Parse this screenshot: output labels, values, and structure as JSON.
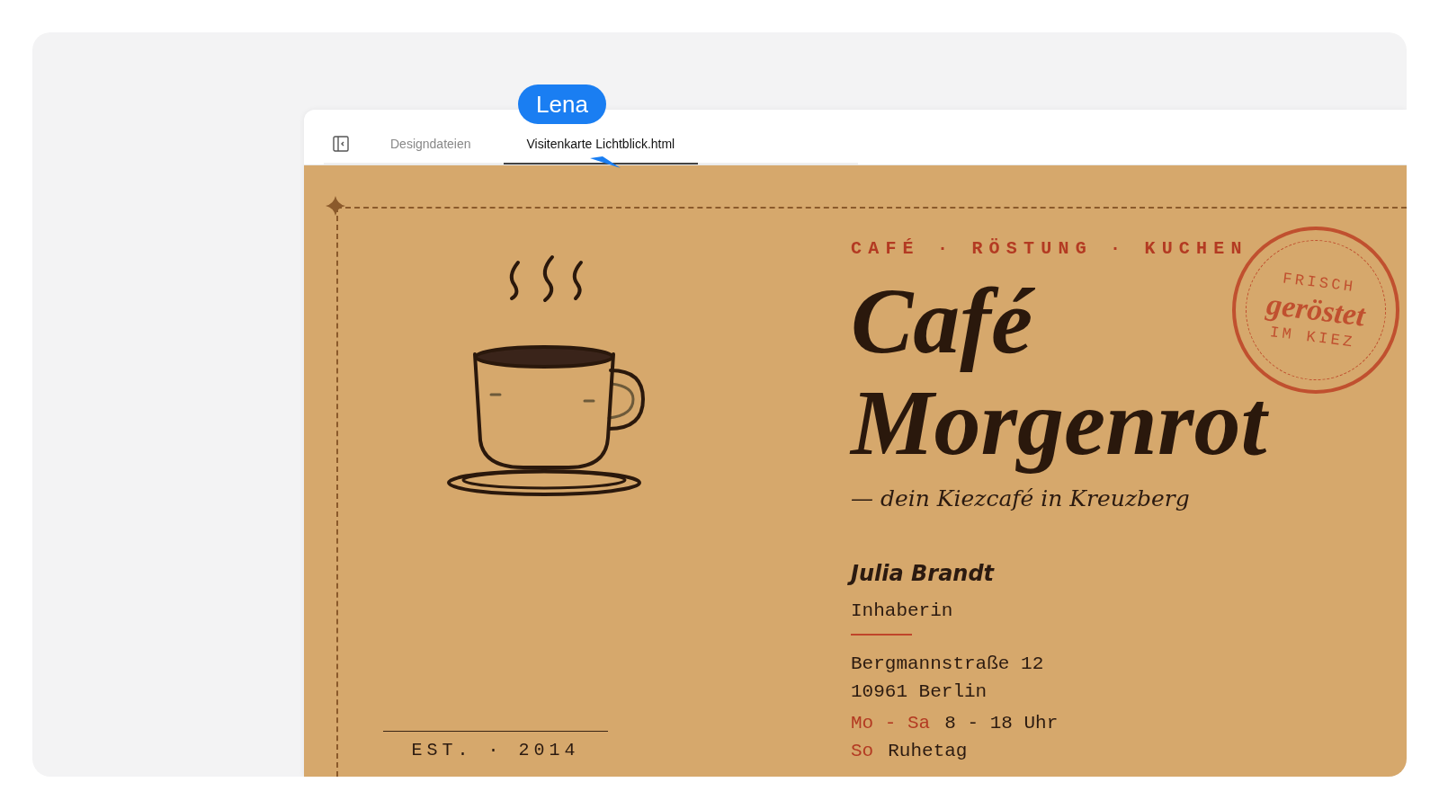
{
  "tabs": [
    {
      "label": "Designdateien",
      "selected": false
    },
    {
      "label": "Visitenkarte Lichtblick.html",
      "selected": true
    }
  ],
  "cursor": {
    "label": "Lena"
  },
  "card": {
    "tagline": "CAFÉ · RÖSTUNG · KUCHEN",
    "title_lines": [
      "Café",
      "Morgenrot"
    ],
    "subtitle": "— dein Kiezcafé in Kreuzberg",
    "name": "Julia Brandt",
    "role": "Inhaberin",
    "address": [
      "Bergmannstraße 12",
      "10961 Berlin"
    ],
    "hours": [
      {
        "days": "Mo - Sa",
        "time": "8 - 18 Uhr"
      },
      {
        "days": "So",
        "time": "Ruhetag"
      }
    ],
    "stamp": {
      "top": "FRISCH",
      "middle": "geröstet",
      "bottom": "IM KIEZ"
    },
    "established": "EST. · 2014"
  }
}
